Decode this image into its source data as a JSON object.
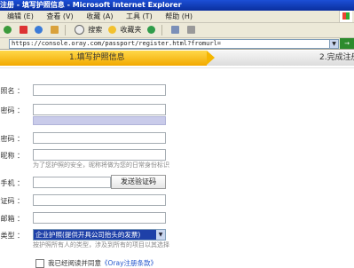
{
  "window": {
    "title": "注册 - 填写护照信息 - Microsoft Internet Explorer"
  },
  "menu": [
    "编辑 (E)",
    "查看 (V)",
    "收藏 (A)",
    "工具 (T)",
    "帮助 (H)"
  ],
  "toolbar": {
    "search": "搜索",
    "favorites": "收藏夹"
  },
  "address": {
    "url": "https://console.oray.com/passport/register.html?fromurl="
  },
  "steps": {
    "step1": "1.填写护照信息",
    "step2": "2.完成注册"
  },
  "form": {
    "passport_name_label": "护照名 ：",
    "password_label": "密码 ：",
    "confirm_password_label": "认密码 ：",
    "nickname_label": "昵称 ：",
    "nickname_hint": "为了您护照的安全，昵称将做为您的日常身份标识",
    "phone_label": "手机 ：",
    "send_code_button": "发送验证码",
    "verify_code_label": "验证码 ：",
    "email_label": "邮箱 ：",
    "passport_type_label": "护照类型 ：",
    "passport_type_value": "企业护照(提供开具公司抬头的发票)",
    "passport_type_hint": "按护照所有人的类型，涉及到所有的项目以其选择",
    "agree_text": "我已经阅读并同意",
    "agree_link": "《Oray注册条款》"
  },
  "colors": {
    "title_bar": "#0a2f9e",
    "step_active": "#f5b600",
    "select_highlight": "#1e40a8"
  }
}
